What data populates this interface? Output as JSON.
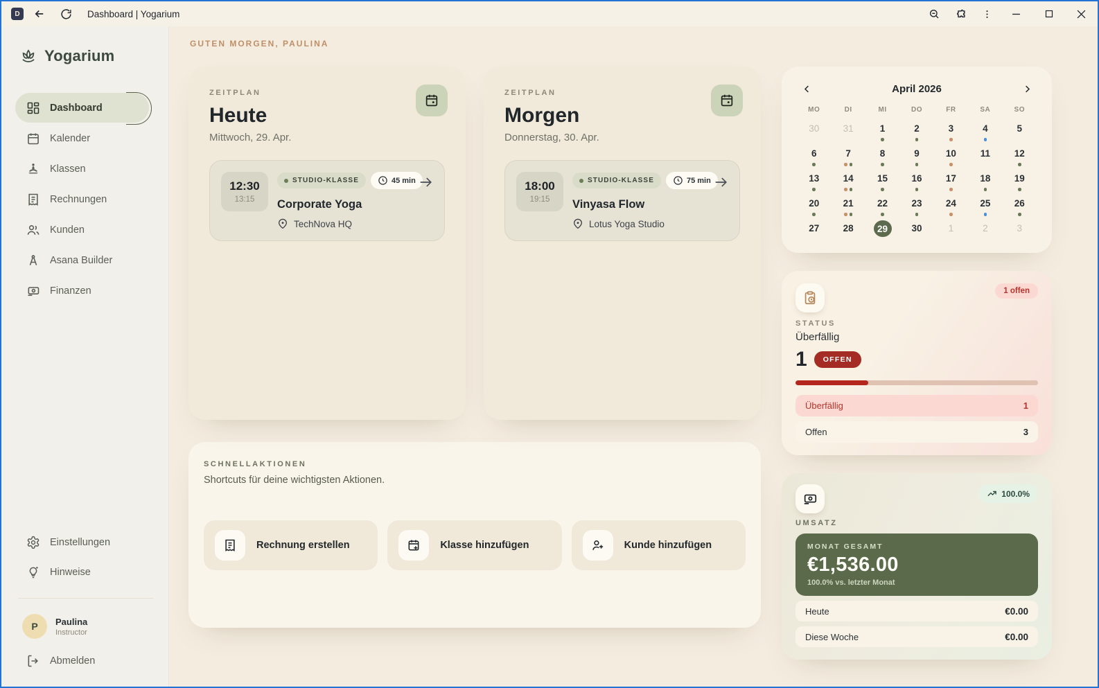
{
  "titlebar": {
    "title": "Dashboard | Yogarium",
    "app_initial": "D"
  },
  "sidebar": {
    "brand": "Yogarium",
    "items": [
      {
        "label": "Dashboard",
        "icon": "dashboard-icon",
        "active": true
      },
      {
        "label": "Kalender",
        "icon": "calendar-icon"
      },
      {
        "label": "Klassen",
        "icon": "yoga-icon"
      },
      {
        "label": "Rechnungen",
        "icon": "invoice-icon"
      },
      {
        "label": "Kunden",
        "icon": "people-icon"
      },
      {
        "label": "Asana Builder",
        "icon": "compass-icon"
      },
      {
        "label": "Finanzen",
        "icon": "banknote-icon"
      }
    ],
    "settings_label": "Einstellungen",
    "hints_label": "Hinweise",
    "profile": {
      "initial": "P",
      "name": "Paulina",
      "role": "Instructor"
    },
    "logout_label": "Abmelden"
  },
  "greeting": "GUTEN MORGEN, PAULINA",
  "schedule_cards": [
    {
      "section_label": "ZEITPLAN",
      "title": "Heute",
      "date": "Mittwoch, 29. Apr.",
      "class": {
        "start": "12:30",
        "end": "13:15",
        "tag": "STUDIO-KLASSE",
        "duration": "45 min",
        "name": "Corporate Yoga",
        "location": "TechNova HQ"
      }
    },
    {
      "section_label": "ZEITPLAN",
      "title": "Morgen",
      "date": "Donnerstag, 30. Apr.",
      "class": {
        "start": "18:00",
        "end": "19:15",
        "tag": "STUDIO-KLASSE",
        "duration": "75 min",
        "name": "Vinyasa Flow",
        "location": "Lotus Yoga Studio"
      }
    }
  ],
  "quick_actions": {
    "section_label": "SCHNELLAKTIONEN",
    "subtitle": "Shortcuts für deine wichtigsten Aktionen.",
    "actions": [
      {
        "label": "Rechnung erstellen",
        "icon": "invoice-icon"
      },
      {
        "label": "Klasse hinzufügen",
        "icon": "calendar-plus-icon"
      },
      {
        "label": "Kunde hinzufügen",
        "icon": "person-plus-icon"
      }
    ]
  },
  "calendar": {
    "month_label": "April 2026",
    "weekdays": [
      "MO",
      "DI",
      "MI",
      "DO",
      "FR",
      "SA",
      "SO"
    ],
    "dot_colors": {
      "green": "#6a7a57",
      "tan": "#c9906a",
      "blue": "#4a90d9"
    },
    "weeks": [
      [
        {
          "day": 30,
          "muted": true
        },
        {
          "day": 31,
          "muted": true
        },
        {
          "day": 1,
          "dots": [
            "green"
          ]
        },
        {
          "day": 2,
          "dots": [
            "green"
          ]
        },
        {
          "day": 3,
          "dots": [
            "tan"
          ]
        },
        {
          "day": 4,
          "dots": [
            "blue"
          ]
        },
        {
          "day": 5
        }
      ],
      [
        {
          "day": 6,
          "dots": [
            "green"
          ]
        },
        {
          "day": 7,
          "dots": [
            "tan",
            "green"
          ]
        },
        {
          "day": 8,
          "dots": [
            "green"
          ]
        },
        {
          "day": 9,
          "dots": [
            "green"
          ]
        },
        {
          "day": 10,
          "dots": [
            "tan"
          ]
        },
        {
          "day": 11
        },
        {
          "day": 12,
          "dots": [
            "green"
          ]
        }
      ],
      [
        {
          "day": 13,
          "dots": [
            "green"
          ]
        },
        {
          "day": 14,
          "dots": [
            "tan",
            "green"
          ]
        },
        {
          "day": 15,
          "dots": [
            "green"
          ]
        },
        {
          "day": 16,
          "dots": [
            "green"
          ]
        },
        {
          "day": 17,
          "dots": [
            "tan"
          ]
        },
        {
          "day": 18,
          "dots": [
            "green"
          ]
        },
        {
          "day": 19,
          "dots": [
            "green"
          ]
        }
      ],
      [
        {
          "day": 20,
          "dots": [
            "green"
          ]
        },
        {
          "day": 21,
          "dots": [
            "tan",
            "green"
          ]
        },
        {
          "day": 22,
          "dots": [
            "green"
          ]
        },
        {
          "day": 23,
          "dots": [
            "green"
          ]
        },
        {
          "day": 24,
          "dots": [
            "tan"
          ]
        },
        {
          "day": 25,
          "dots": [
            "blue"
          ]
        },
        {
          "day": 26,
          "dots": [
            "green"
          ]
        }
      ],
      [
        {
          "day": 27
        },
        {
          "day": 28
        },
        {
          "day": 29,
          "selected": true
        },
        {
          "day": 30
        },
        {
          "day": 1,
          "muted": true
        },
        {
          "day": 2,
          "muted": true
        },
        {
          "day": 3,
          "muted": true
        }
      ]
    ]
  },
  "status_card": {
    "badge": "1 offen",
    "section_label": "STATUS",
    "subtitle": "Überfällig",
    "count": "1",
    "count_badge": "OFFEN",
    "progress_percent": 30,
    "rows": [
      {
        "label": "Überfällig",
        "value": "1"
      },
      {
        "label": "Offen",
        "value": "3"
      }
    ]
  },
  "revenue_card": {
    "badge": "100.0%",
    "section_label": "UMSATZ",
    "total_label": "MONAT GESAMT",
    "total": "€1,536.00",
    "total_sub": "100.0% vs. letzter Monat",
    "rows": [
      {
        "label": "Heute",
        "value": "€0.00"
      },
      {
        "label": "Diese Woche",
        "value": "€0.00"
      }
    ]
  },
  "colors": {
    "accent_green": "#5c6b4e",
    "alert_red": "#b3271f",
    "badge_pink": "#fbd9d2",
    "brand_text": "#3c4a3f",
    "greeting_tan": "#bf8f69",
    "window_border_blue": "#2373d4"
  }
}
